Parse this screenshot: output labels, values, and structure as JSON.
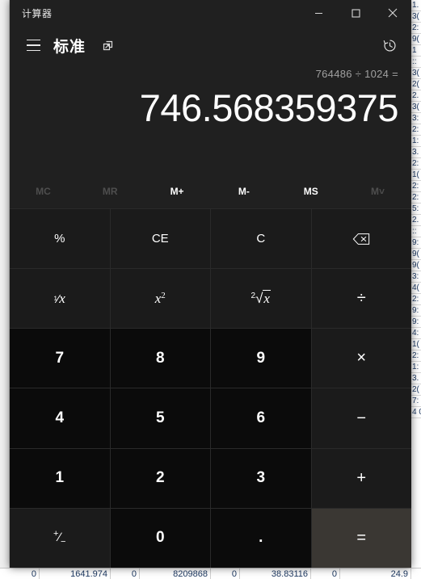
{
  "window": {
    "title": "计算器",
    "controls": {
      "minimize": "minimize",
      "maximize": "maximize",
      "close": "close"
    }
  },
  "modebar": {
    "menu_label": "menu",
    "mode_title": "标准",
    "keep_on_top_label": "keep-on-top",
    "history_label": "history"
  },
  "display": {
    "expression": "764486 ÷ 1024 =",
    "result": "746.568359375"
  },
  "memory": [
    {
      "label": "MC",
      "enabled": false
    },
    {
      "label": "MR",
      "enabled": false
    },
    {
      "label": "M+",
      "enabled": true
    },
    {
      "label": "M-",
      "enabled": true
    },
    {
      "label": "MS",
      "enabled": true
    },
    {
      "label": "M˅",
      "enabled": false
    }
  ],
  "keys": [
    {
      "label": "%",
      "type": "fn",
      "name": "percent"
    },
    {
      "label": "CE",
      "type": "fn",
      "name": "clear-entry"
    },
    {
      "label": "C",
      "type": "fn",
      "name": "clear"
    },
    {
      "label": "⌫",
      "type": "fn",
      "name": "backspace"
    },
    {
      "label": "¹⁄x",
      "type": "fn",
      "name": "reciprocal"
    },
    {
      "label": "x²",
      "type": "fn",
      "name": "square"
    },
    {
      "label": "²√x",
      "type": "fn",
      "name": "square-root"
    },
    {
      "label": "÷",
      "type": "op",
      "name": "divide"
    },
    {
      "label": "7",
      "type": "num",
      "name": "seven"
    },
    {
      "label": "8",
      "type": "num",
      "name": "eight"
    },
    {
      "label": "9",
      "type": "num",
      "name": "nine"
    },
    {
      "label": "×",
      "type": "op",
      "name": "multiply"
    },
    {
      "label": "4",
      "type": "num",
      "name": "four"
    },
    {
      "label": "5",
      "type": "num",
      "name": "five"
    },
    {
      "label": "6",
      "type": "num",
      "name": "six"
    },
    {
      "label": "−",
      "type": "op",
      "name": "subtract"
    },
    {
      "label": "1",
      "type": "num",
      "name": "one"
    },
    {
      "label": "2",
      "type": "num",
      "name": "two"
    },
    {
      "label": "3",
      "type": "num",
      "name": "three"
    },
    {
      "label": "+",
      "type": "op",
      "name": "add"
    },
    {
      "label": "⁺∕₋",
      "type": "fn",
      "name": "negate"
    },
    {
      "label": "0",
      "type": "num",
      "name": "zero"
    },
    {
      "label": ".",
      "type": "num",
      "name": "decimal"
    },
    {
      "label": "=",
      "type": "equals",
      "name": "equals"
    }
  ],
  "background_spreadsheet": {
    "bottom_row_cells": [
      "0",
      "1641.974",
      "0",
      "8209868",
      "0",
      "38.83116",
      "0",
      "24.9"
    ],
    "right_column_values": [
      "1.",
      "3(",
      "2:",
      "9(",
      "1",
      "::",
      "3(",
      "2(",
      "2.",
      "3(",
      "3:",
      "2:",
      "1:",
      "3.",
      "2:",
      "1(",
      "2:",
      "2:",
      "5:",
      "2.",
      "::",
      "9:",
      "9(",
      "9(",
      "3:",
      "4(",
      "2:",
      "9:",
      "9:",
      "4:",
      "1(",
      "2:",
      "1:",
      "3.",
      "2(",
      "7:",
      "4 0"
    ]
  },
  "colors": {
    "window_bg": "#202020",
    "number_key": "#0b0b0b",
    "function_key": "#1b1b1b",
    "equals_key": "#3a3733",
    "text": "#ffffff",
    "muted_text": "#a0a0a0",
    "disabled_text": "#4e4e4e"
  }
}
